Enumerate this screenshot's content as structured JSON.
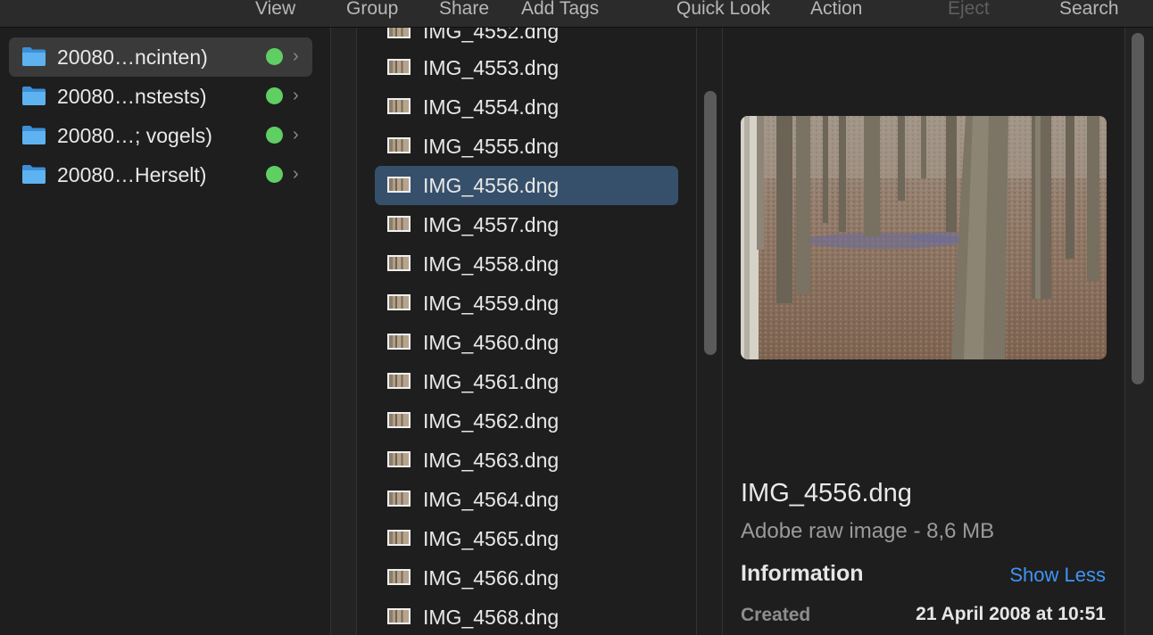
{
  "toolbar": {
    "items": [
      {
        "label": "View",
        "enabled": true
      },
      {
        "label": "Group",
        "enabled": true
      },
      {
        "label": "Share",
        "enabled": true
      },
      {
        "label": "Add Tags",
        "enabled": true
      },
      {
        "label": "Quick Look",
        "enabled": true
      },
      {
        "label": "Action",
        "enabled": true
      },
      {
        "label": "Eject",
        "enabled": false
      },
      {
        "label": "Search",
        "enabled": true
      }
    ]
  },
  "sidebar_column": {
    "items": [
      {
        "label": "20080…ncinten)",
        "tag_color": "#5fcf63",
        "selected": true
      },
      {
        "label": "20080…nstests)",
        "tag_color": "#5fcf63",
        "selected": false
      },
      {
        "label": "20080…; vogels)",
        "tag_color": "#5fcf63",
        "selected": false
      },
      {
        "label": "20080…Herselt)",
        "tag_color": "#5fcf63",
        "selected": false
      }
    ]
  },
  "file_column": {
    "files": [
      "IMG_4552.dng",
      "IMG_4553.dng",
      "IMG_4554.dng",
      "IMG_4555.dng",
      "IMG_4556.dng",
      "IMG_4557.dng",
      "IMG_4558.dng",
      "IMG_4559.dng",
      "IMG_4560.dng",
      "IMG_4561.dng",
      "IMG_4562.dng",
      "IMG_4563.dng",
      "IMG_4564.dng",
      "IMG_4565.dng",
      "IMG_4566.dng",
      "IMG_4568.dng"
    ],
    "selected": "IMG_4556.dng"
  },
  "preview": {
    "title": "IMG_4556.dng",
    "subtitle": "Adobe raw image - 8,6 MB",
    "info_heading": "Information",
    "show_less_label": "Show Less",
    "metadata": [
      {
        "key": "Created",
        "value": "21 April 2008 at 10:51"
      }
    ]
  },
  "colors": {
    "accent_link": "#3e95f4",
    "selection": "#36506b",
    "tag_green": "#5fcf63",
    "folder_blue": "#4aa3e8"
  }
}
